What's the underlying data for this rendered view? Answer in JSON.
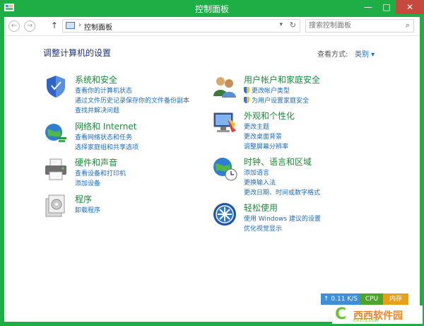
{
  "window": {
    "title": "控制面板"
  },
  "nav": {
    "back": "←",
    "forward": "→",
    "up": "↑",
    "address_sep": "›",
    "address": "控制面板",
    "dropdown": "▾",
    "refresh": "↻",
    "search_placeholder": "搜索控制面板",
    "search_icon": "⌕"
  },
  "main": {
    "heading": "调整计算机的设置",
    "view_by": "查看方式:",
    "category": "类别 ▾"
  },
  "groups": [
    {
      "title": "系统和安全",
      "icon": "shield-icon",
      "links": [
        "查看你的计算机状态",
        "通过文件历史记录保存你的文件备份副本",
        "查找并解决问题"
      ]
    },
    {
      "title": "网络和 Internet",
      "icon": "network-globe-icon",
      "links": [
        "查看网络状态和任务",
        "选择家庭组和共享选项"
      ]
    },
    {
      "title": "硬件和声音",
      "icon": "printer-icon",
      "links": [
        "查看设备和打印机",
        "添加设备"
      ]
    },
    {
      "title": "程序",
      "icon": "programs-icon",
      "links": [
        "卸载程序"
      ]
    },
    {
      "title": "用户帐户和家庭安全",
      "icon": "users-icon",
      "links": [
        "更改帐户类型",
        "为用户设置家庭安全"
      ]
    },
    {
      "title": "外观和个性化",
      "icon": "appearance-icon",
      "links": [
        "更改主题",
        "更改桌面背景",
        "调整屏幕分辨率"
      ]
    },
    {
      "title": "时钟、语言和区域",
      "icon": "clock-globe-icon",
      "links": [
        "添加语言",
        "更换输入法",
        "更改日期、时间或数字格式"
      ]
    },
    {
      "title": "轻松使用",
      "icon": "ease-of-access-icon",
      "links": [
        "使用 Windows 建议的设置",
        "优化视觉显示"
      ]
    }
  ],
  "widget": {
    "net": "↑ 0.11 K/S",
    "cpu": "CPU",
    "mem": "内存"
  },
  "watermark": {
    "brand": "西西软件园",
    "site": "CR173.COM"
  },
  "colors": {
    "title_bar": "#1fae45",
    "close": "#c7483c",
    "group_title": "#1b8a3c",
    "link": "#1e6bb8"
  }
}
